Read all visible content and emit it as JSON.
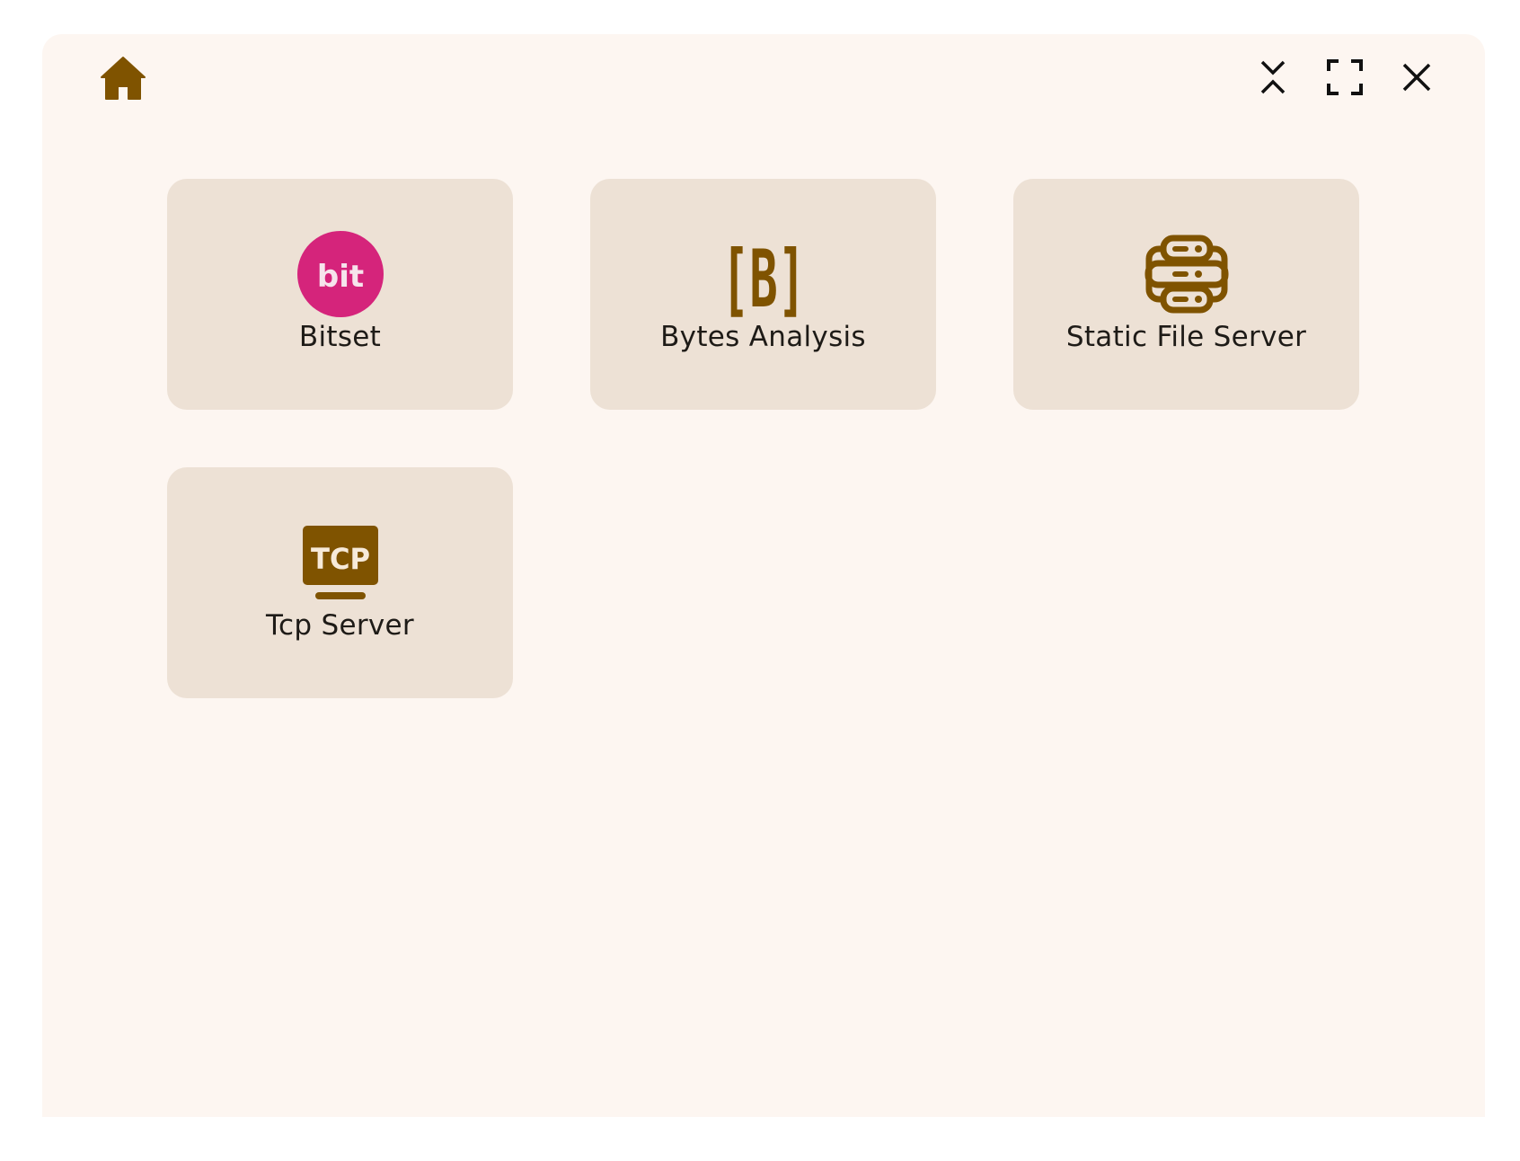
{
  "window": {
    "background": "#fdf6f1",
    "home_icon": "home-icon",
    "controls": [
      {
        "icon": "collapse-icon"
      },
      {
        "icon": "fullscreen-icon"
      },
      {
        "icon": "close-icon"
      }
    ]
  },
  "colors": {
    "accent_brown": "#7f5300",
    "card_bg": "#ede1d5",
    "bitset_pink": "#d5247b"
  },
  "apps": [
    {
      "label": "Bitset",
      "icon": "bitset-icon",
      "icon_text": "bit"
    },
    {
      "label": "Bytes Analysis",
      "icon": "bytes-bracket-icon",
      "icon_text": "[B]"
    },
    {
      "label": "Static File Server",
      "icon": "server-stack-icon"
    },
    {
      "label": "Tcp Server",
      "icon": "tcp-monitor-icon",
      "icon_text": "TCP"
    }
  ]
}
